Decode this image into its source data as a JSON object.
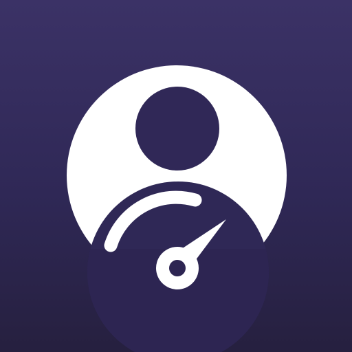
{
  "icon": {
    "name": "user-speedometer-icon",
    "foreground_color": "#ffffff",
    "background_top_color": "#3b3266",
    "background_bottom_color": "#26203f"
  }
}
